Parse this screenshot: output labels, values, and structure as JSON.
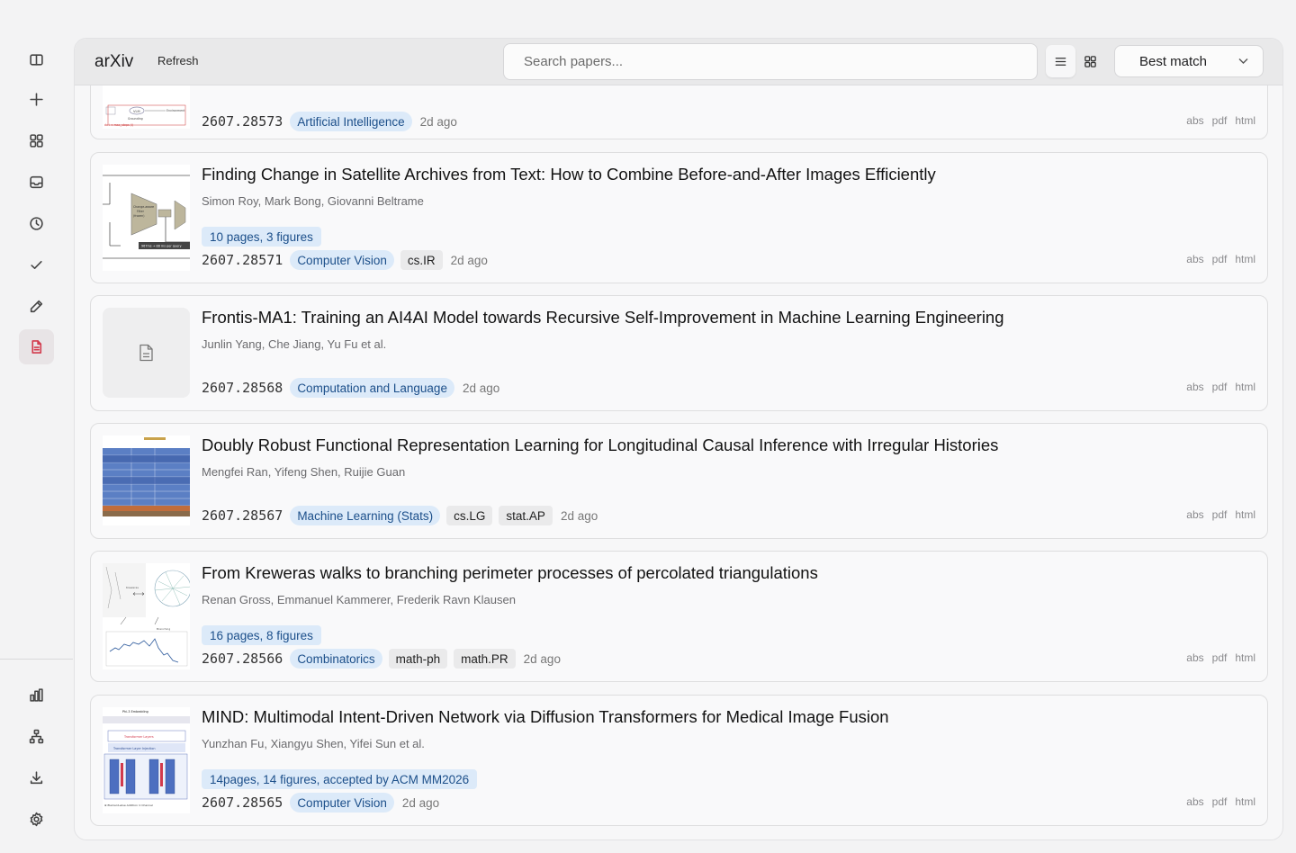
{
  "header": {
    "brand": "arXiv",
    "refresh_label": "Refresh",
    "search_placeholder": "Search papers...",
    "sort_label": "Best match"
  },
  "rail": {
    "top_icons": [
      "panel-icon",
      "plus-icon",
      "grid-icon",
      "inbox-icon",
      "clock-icon",
      "check-icon",
      "pencil-icon",
      "document-icon"
    ],
    "bottom_icons": [
      "bar-chart-icon",
      "network-icon",
      "download-icon",
      "settings-icon"
    ],
    "active": "document-icon",
    "accent_color": "#d23a4c"
  },
  "papers": [
    {
      "id": "2607.28573",
      "title": "",
      "authors": "",
      "comment": "",
      "primary_category": "Artificial Intelligence",
      "other_categories": [],
      "age": "2d ago"
    },
    {
      "id": "2607.28571",
      "title": "Finding Change in Satellite Archives from Text: How to Combine Before-and-After Images Efficiently",
      "authors": "Simon Roy, Mark Bong, Giovanni Beltrame",
      "comment": "10 pages, 3 figures",
      "primary_category": "Computer Vision",
      "other_categories": [
        "cs.IR"
      ],
      "age": "2d ago"
    },
    {
      "id": "2607.28568",
      "title": "Frontis-MA1: Training an AI4AI Model towards Recursive Self-Improvement in Machine Learning Engineering",
      "authors": "Junlin Yang, Che Jiang, Yu Fu et al.",
      "comment": "",
      "primary_category": "Computation and Language",
      "other_categories": [],
      "age": "2d ago"
    },
    {
      "id": "2607.28567",
      "title": "Doubly Robust Functional Representation Learning for Longitudinal Causal Inference with Irregular Histories",
      "authors": "Mengfei Ran, Yifeng Shen, Ruijie Guan",
      "comment": "",
      "primary_category": "Machine Learning (Stats)",
      "other_categories": [
        "cs.LG",
        "stat.AP"
      ],
      "age": "2d ago"
    },
    {
      "id": "2607.28566",
      "title": "From Kreweras walks to branching perimeter processes of percolated triangulations",
      "authors": "Renan Gross, Emmanuel Kammerer, Frederik Ravn Klausen",
      "comment": "16 pages, 8 figures",
      "primary_category": "Combinatorics",
      "other_categories": [
        "math-ph",
        "math.PR"
      ],
      "age": "2d ago"
    },
    {
      "id": "2607.28565",
      "title": "MIND: Multimodal Intent-Driven Network via Diffusion Transformers for Medical Image Fusion",
      "authors": "Yunzhan Fu, Xiangyu Shen, Yifei Sun et al.",
      "comment": "14pages, 14 figures, accepted by ACM MM2026",
      "primary_category": "Computer Vision",
      "other_categories": [],
      "age": "2d ago"
    }
  ],
  "links": {
    "abs": "abs",
    "pdf": "pdf",
    "html": "html"
  }
}
